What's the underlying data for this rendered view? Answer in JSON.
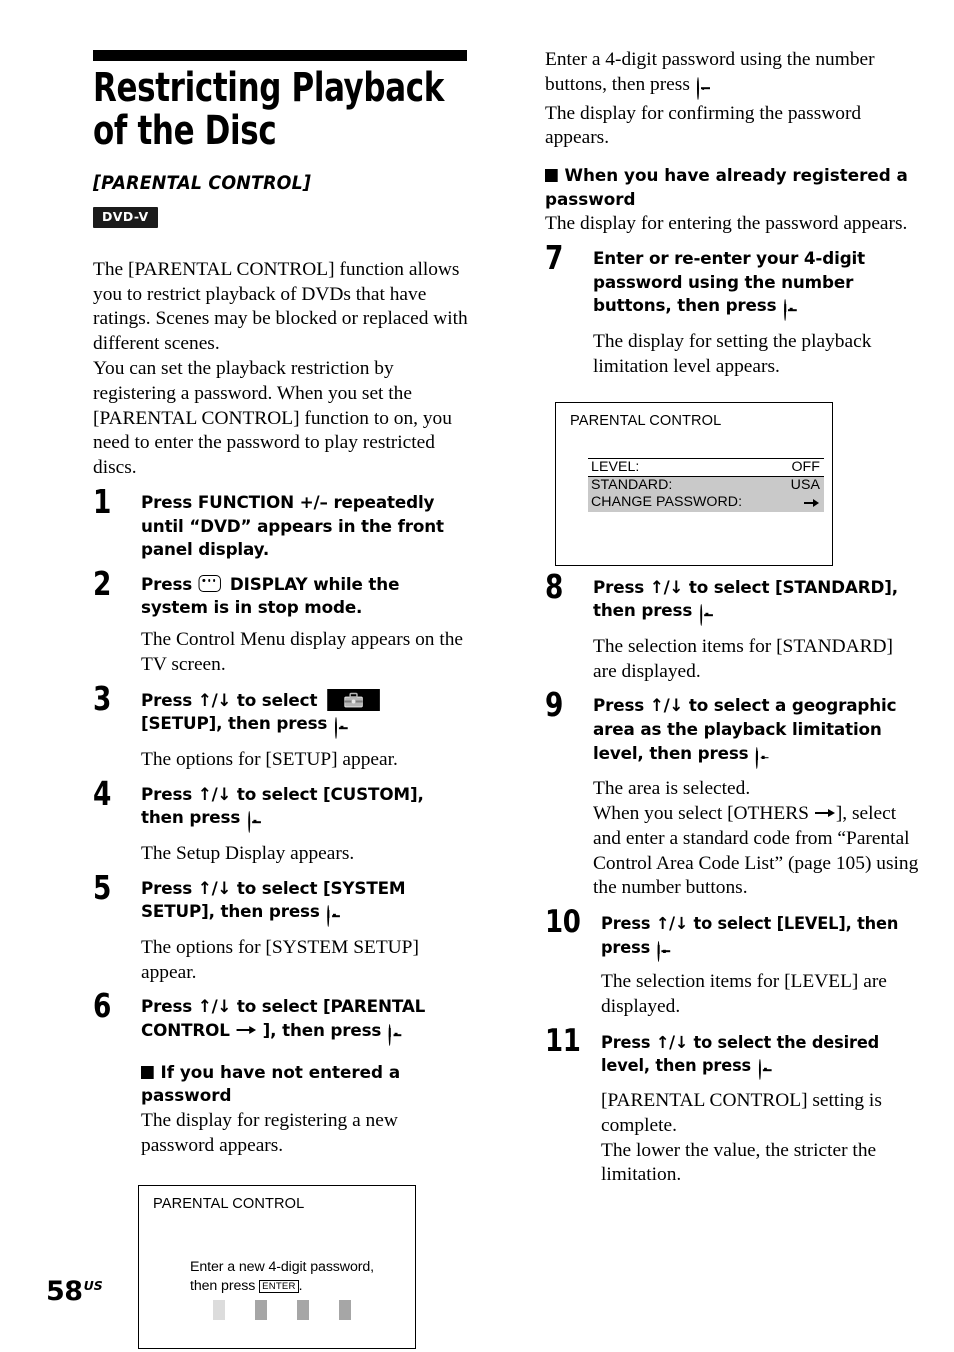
{
  "page": {
    "number": "58",
    "region_suffix": "US"
  },
  "header": {
    "title": "Restricting Playback of the Disc",
    "subtitle": "[PARENTAL CONTROL]",
    "disc_badge": "DVD-V"
  },
  "intro": {
    "paragraph_1": "The [PARENTAL CONTROL] function allows you to restrict playback of DVDs that have ratings. Scenes may be blocked or replaced with different scenes.",
    "paragraph_2": "You can set the playback restriction by registering a password. When you set the [PARENTAL CONTROL] function to on, you need to enter the password to play restricted discs."
  },
  "steps": {
    "s1": {
      "num": "1",
      "head_a": "Press FUNCTION +/– repeatedly until “DVD” appears in the front panel display."
    },
    "s2": {
      "num": "2",
      "head_a": "Press",
      "head_b": "DISPLAY while the system is in stop mode.",
      "body": "The Control Menu display appears on the TV screen."
    },
    "s3": {
      "num": "3",
      "head_a": "Press",
      "head_updown": "↑/↓",
      "head_b": "to select",
      "head_c": "[SETUP], then press",
      "head_d": ".",
      "body": "The options for [SETUP] appear."
    },
    "s4": {
      "num": "4",
      "head_a": "Press",
      "head_updown": "↑/↓",
      "head_b": "to select [CUSTOM], then press",
      "head_c": ".",
      "body": "The Setup Display appears."
    },
    "s5": {
      "num": "5",
      "head_a": "Press",
      "head_updown": "↑/↓",
      "head_b": "to select [SYSTEM SETUP], then press",
      "head_c": ".",
      "body": "The options for [SYSTEM SETUP] appear."
    },
    "s6": {
      "num": "6",
      "head_a": "Press",
      "head_updown": "↑/↓",
      "head_b": "to select [PARENTAL CONTROL",
      "head_c": "], then press",
      "head_d": "."
    },
    "s7": {
      "num": "7",
      "head_a": "Enter or re-enter your 4-digit password using the number buttons, then press",
      "head_b": ".",
      "body": "The display for setting the playback limitation level appears."
    },
    "s8": {
      "num": "8",
      "head_a": "Press",
      "head_updown": "↑/↓",
      "head_b": "to select [STANDARD], then press",
      "head_c": ".",
      "body": "The selection items for [STANDARD] are displayed."
    },
    "s9": {
      "num": "9",
      "head_a": "Press",
      "head_updown": "↑/↓",
      "head_b": "to select a geographic area as the playback limitation level, then press",
      "head_c": ".",
      "body_1": "The area is selected.",
      "body_2a": "When you select [OTHERS",
      "body_2b": "], select and enter a standard code from “Parental Control Area Code List” (page 105) using the number buttons."
    },
    "s10": {
      "num": "10",
      "head_a": "Press",
      "head_updown": "↑/↓",
      "head_b": "to select [LEVEL], then press",
      "head_c": ".",
      "body": "The selection items for [LEVEL] are displayed."
    },
    "s11": {
      "num": "11",
      "head_a": "Press",
      "head_updown": "↑/↓",
      "head_b": "to select the desired level, then press",
      "head_c": ".",
      "body_1": "[PARENTAL CONTROL] setting is complete.",
      "body_2": "The lower the value, the stricter the limitation."
    }
  },
  "subheads": {
    "not_entered": {
      "heading": "If you have not entered a password",
      "body": "The display for registering a new password appears."
    },
    "already_registered": {
      "heading": "When you have already registered a password",
      "body": "The display for entering the password appears."
    }
  },
  "right_top": {
    "paragraph_1a": "Enter a 4-digit password using the number buttons, then press",
    "paragraph_1b": ".",
    "paragraph_2": "The display for confirming the password appears."
  },
  "osd_password": {
    "title": "PARENTAL CONTROL",
    "line_1": "Enter a new 4-digit password,",
    "line_2a": "then press",
    "enter_key": "ENTER",
    "line_2b": ".",
    "boxes": [
      {
        "color": "#dcdcdc"
      },
      {
        "color": "#a6a6a6"
      },
      {
        "color": "#a6a6a6"
      },
      {
        "color": "#a6a6a6"
      }
    ]
  },
  "osd_settings": {
    "title": "PARENTAL CONTROL",
    "rows": [
      {
        "label": "LEVEL:",
        "value": "OFF",
        "selected": true
      },
      {
        "label": "STANDARD:",
        "value": "USA",
        "selected": false
      },
      {
        "label": "CHANGE PASSWORD:",
        "value": "→",
        "selected": false
      }
    ]
  },
  "colors": {
    "ink": "#000000",
    "paper": "#ffffff",
    "osd_row_gray": "#c9c9c9",
    "pw_box_active": "#dcdcdc",
    "pw_box_idle": "#a6a6a6",
    "badge_bg": "#1b1b1b"
  }
}
